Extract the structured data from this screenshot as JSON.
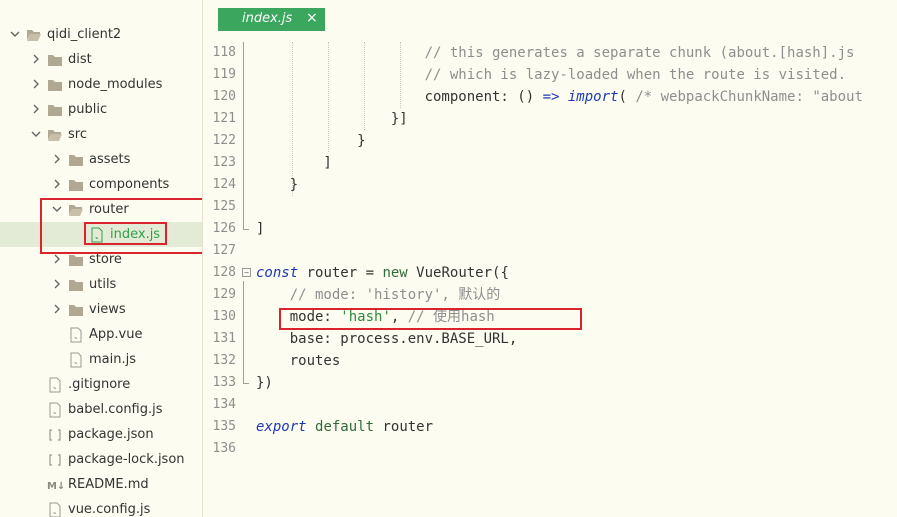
{
  "sidebar": {
    "items": [
      {
        "name": "qidi_client2",
        "type": "folder",
        "expanded": true,
        "depth": 0
      },
      {
        "name": "dist",
        "type": "folder",
        "expanded": false,
        "depth": 1
      },
      {
        "name": "node_modules",
        "type": "folder",
        "expanded": false,
        "depth": 1
      },
      {
        "name": "public",
        "type": "folder",
        "expanded": false,
        "depth": 1
      },
      {
        "name": "src",
        "type": "folder",
        "expanded": true,
        "depth": 1
      },
      {
        "name": "assets",
        "type": "folder",
        "expanded": false,
        "depth": 2
      },
      {
        "name": "components",
        "type": "folder",
        "expanded": false,
        "depth": 2
      },
      {
        "name": "router",
        "type": "folder",
        "expanded": true,
        "depth": 2
      },
      {
        "name": "index.js",
        "type": "file",
        "selected": true,
        "depth": 3
      },
      {
        "name": "store",
        "type": "folder",
        "expanded": false,
        "depth": 2
      },
      {
        "name": "utils",
        "type": "folder",
        "expanded": false,
        "depth": 2
      },
      {
        "name": "views",
        "type": "folder",
        "expanded": false,
        "depth": 2
      },
      {
        "name": "App.vue",
        "type": "file",
        "depth": 2
      },
      {
        "name": "main.js",
        "type": "file",
        "depth": 2
      },
      {
        "name": ".gitignore",
        "type": "file",
        "depth": 1
      },
      {
        "name": "babel.config.js",
        "type": "file",
        "depth": 1
      },
      {
        "name": "package.json",
        "type": "json",
        "depth": 1
      },
      {
        "name": "package-lock.json",
        "type": "json",
        "depth": 1
      },
      {
        "name": "README.md",
        "type": "md",
        "depth": 1
      },
      {
        "name": "vue.config.js",
        "type": "file",
        "depth": 1
      }
    ]
  },
  "editor": {
    "tab": {
      "label": "index.js",
      "close": "×"
    },
    "lines": [
      {
        "n": "118",
        "code": "                    // this generates a separate chunk (about.[hash].js"
      },
      {
        "n": "119",
        "code": "                    // which is lazy-loaded when the route is visited."
      },
      {
        "n": "120",
        "code": "                    component: () => import( /* webpackChunkName: \"about"
      },
      {
        "n": "121",
        "code": "                }]"
      },
      {
        "n": "122",
        "code": "            }"
      },
      {
        "n": "123",
        "code": "        ]"
      },
      {
        "n": "124",
        "code": "    }"
      },
      {
        "n": "125",
        "code": ""
      },
      {
        "n": "126",
        "code": "]"
      },
      {
        "n": "127",
        "code": ""
      },
      {
        "n": "128",
        "code": "const router = new VueRouter({"
      },
      {
        "n": "129",
        "code": "    // mode: 'history', 默认的"
      },
      {
        "n": "130",
        "code": "    mode: 'hash', // 使用hash"
      },
      {
        "n": "131",
        "code": "    base: process.env.BASE_URL,"
      },
      {
        "n": "132",
        "code": "    routes"
      },
      {
        "n": "133",
        "code": "})"
      },
      {
        "n": "134",
        "code": ""
      },
      {
        "n": "135",
        "code": "export default router"
      },
      {
        "n": "136",
        "code": ""
      }
    ]
  },
  "colors": {
    "background": "#fdfcf0",
    "tab": "#3ba65d",
    "selection": "#e3ebd6",
    "highlight_box": "#d9232d",
    "keyword": "#1c39b5",
    "string": "#2b8a3e",
    "comment": "#8e8e8e"
  }
}
